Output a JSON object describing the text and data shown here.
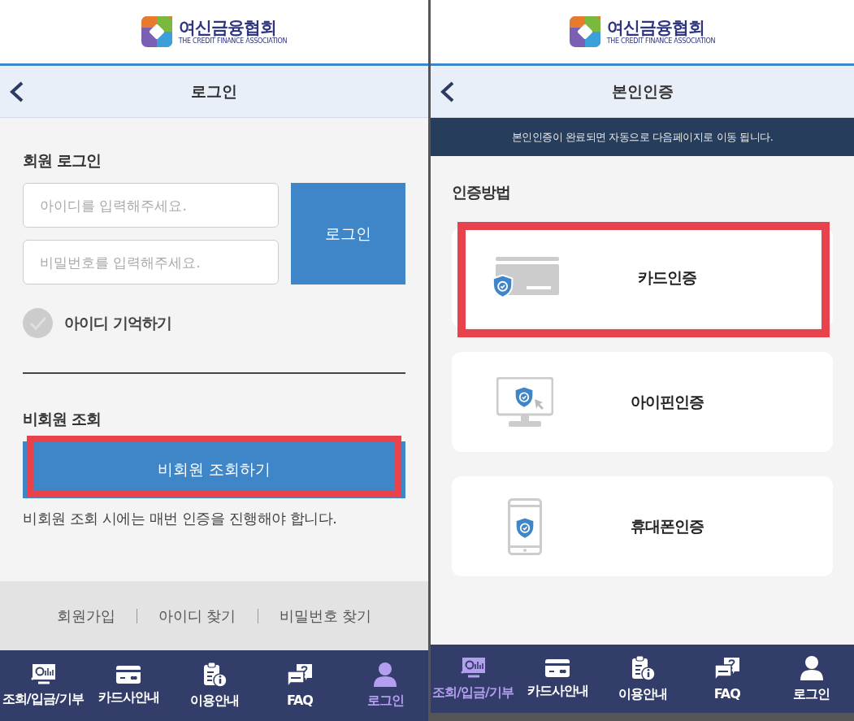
{
  "login_screen": {
    "logo": {
      "name": "여신금융협회",
      "subtitle": "THE CREDIT FINANCE ASSOCIATION"
    },
    "title": "로그인",
    "member_heading": "회원 로그인",
    "id_field": {
      "placeholder": "아이디를 입력해주세요."
    },
    "password_field": {
      "placeholder": "비밀번호를 입력해주세요."
    },
    "login_button": "로그인",
    "remember_id": {
      "label": "아이디 기억하기",
      "checked": false
    },
    "guest_heading": "비회원 조회",
    "guest_button": {
      "label": "비회원 조회하기",
      "highlighted": true
    },
    "guest_note": "비회원 조회 시에는 매번 인증을 진행해야 합니다.",
    "footer_links": [
      "회원가입",
      "아이디 찾기",
      "비밀번호 찾기"
    ],
    "nav": [
      {
        "label": "조회/입금/기부",
        "selected": false
      },
      {
        "label": "카드사안내",
        "selected": false
      },
      {
        "label": "이용안내",
        "selected": false
      },
      {
        "label": "FAQ",
        "selected": false
      },
      {
        "label": "로그인",
        "selected": true
      }
    ]
  },
  "verify_screen": {
    "logo": {
      "name": "여신금융협회",
      "subtitle": "THE CREDIT FINANCE ASSOCIATION"
    },
    "title": "본인인증",
    "notice": "본인인증이 완료되면 자동으로 다음페이지로 이동 됩니다.",
    "methods_heading": "인증방법",
    "methods": [
      {
        "kind": "card",
        "label": "카드인증",
        "highlighted": true
      },
      {
        "kind": "ipin",
        "label": "아이핀인증",
        "highlighted": false
      },
      {
        "kind": "phone",
        "label": "휴대폰인증",
        "highlighted": false
      }
    ],
    "nav": [
      {
        "label": "조회/입금/기부",
        "selected": true
      },
      {
        "label": "카드사안내",
        "selected": false
      },
      {
        "label": "이용안내",
        "selected": false
      },
      {
        "label": "FAQ",
        "selected": false
      },
      {
        "label": "로그인",
        "selected": false
      }
    ]
  }
}
